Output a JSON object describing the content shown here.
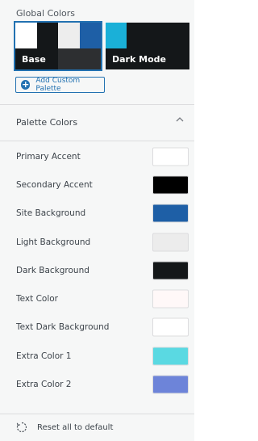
{
  "global_colors": {
    "title": "Global Colors",
    "palettes": [
      {
        "label": "Base",
        "top_colors": [
          "#ffffff",
          "#141719",
          "#ededed",
          "#1e5fa6"
        ],
        "bottom_colors": [
          "#141719",
          "#141719",
          "#2d2f31",
          "#2d2f31"
        ],
        "selected": true
      },
      {
        "label": "Dark Mode",
        "top_colors": [
          "#1ab0d8",
          "#141719",
          "#141719",
          "#141719"
        ],
        "bottom_colors": [
          "#141719",
          "#141719",
          "#141719",
          "#141719"
        ],
        "selected": false
      }
    ],
    "add_button_label": "Add Custom Palette",
    "add_icon": "plus-circle-icon"
  },
  "palette_section": {
    "title": "Palette Colors",
    "toggle_icon": "chevron-up-icon",
    "rows": [
      {
        "label": "Primary Accent",
        "color": "#ffffff"
      },
      {
        "label": "Secondary Accent",
        "color": "#000000"
      },
      {
        "label": "Site Background",
        "color": "#1e5fa6"
      },
      {
        "label": "Light Background",
        "color": "#ececec"
      },
      {
        "label": "Dark Background",
        "color": "#141719"
      },
      {
        "label": "Text Color",
        "color": "#fff8f8"
      },
      {
        "label": "Text Dark Background",
        "color": "#ffffff"
      },
      {
        "label": "Extra Color 1",
        "color": "#5ad9e2"
      },
      {
        "label": "Extra Color 2",
        "color": "#6d84d9"
      }
    ]
  },
  "reset": {
    "label": "Reset all to default",
    "icon": "reset-icon"
  }
}
